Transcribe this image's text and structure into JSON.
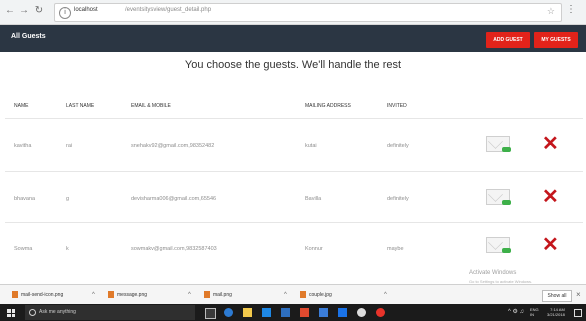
{
  "browser": {
    "url_host": "localhost",
    "url_path": "/eventsitysview/guest_detail.php"
  },
  "app": {
    "title": "All Guests",
    "add_guest_label": "ADD GUEST",
    "my_guests_label": "MY GUESTS",
    "tagline": "You choose the guests. We'll handle the rest"
  },
  "table": {
    "headers": [
      "NAME",
      "LAST NAME",
      "EMAIL & MOBILE",
      "MAILING ADDRESS",
      "INVITED"
    ],
    "rows": [
      {
        "name": "kavitha",
        "last_name": "rai",
        "email_mobile": "snehakv92@gmail.com,98352482",
        "address": "kutai",
        "invited": "definitely"
      },
      {
        "name": "bhavana",
        "last_name": "g",
        "email_mobile": "devisharma006@gmail.com,65546",
        "address": "Bavilla",
        "invited": "definitely"
      },
      {
        "name": "Sowma",
        "last_name": "k",
        "email_mobile": "sowmakv@gmail.com,9832587403",
        "address": "Konnur",
        "invited": "maybe"
      }
    ]
  },
  "watermark": {
    "line1": "Activate Windows",
    "line2": "Go to Settings to activate Windows."
  },
  "downloads": {
    "items": [
      "mail-send-icon.png",
      "message.png",
      "mail.png",
      "couple.jpg"
    ],
    "show_all": "Show all"
  },
  "taskbar": {
    "search_placeholder": "Ask me anything",
    "lang_top": "ENG",
    "lang_bottom": "IN",
    "time": "7:14 AM",
    "date": "3/21/2018"
  }
}
